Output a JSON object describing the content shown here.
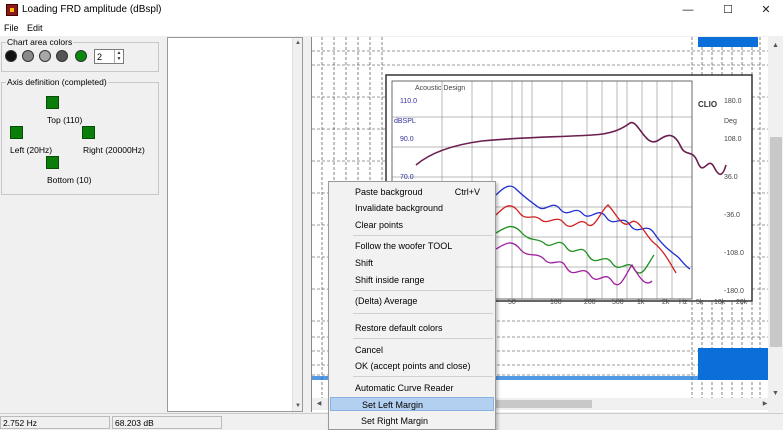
{
  "window": {
    "title": "Loading FRD amplitude (dBspl)",
    "minimize": "—",
    "maximize": "☐",
    "close": "✕"
  },
  "menu": [
    "File",
    "Edit"
  ],
  "chart_area_colors": {
    "label": "Chart area colors",
    "dots": [
      "#111111",
      "#8a8a8a",
      "#a8a8a8",
      "#555555",
      "#0a8a0a"
    ],
    "spin_value": "2"
  },
  "axis_definition": {
    "label": "Axis definition (completed)",
    "top": "Top (110)",
    "left": "Left (20Hz)",
    "right": "Right (20000Hz)",
    "bottom": "Bottom (10)"
  },
  "chart": {
    "inner_label": "Acoustic Design",
    "brand": "CLIO",
    "left_ticks": [
      "110.0",
      "dBSPL",
      "90.0",
      "70.0"
    ],
    "right_ticks": [
      "180.0",
      "Deg",
      "108.0",
      "36.0",
      "-36.0",
      "-108.0",
      "-180.0"
    ],
    "x_ticks": [
      "50",
      "100",
      "200",
      "500",
      "1k",
      "2k",
      "Hz",
      "5k",
      "10k",
      "20k"
    ]
  },
  "context_menu": {
    "items": [
      {
        "label": "Paste backgroud",
        "shortcut": "Ctrl+V"
      },
      {
        "label": "Invalidate background"
      },
      {
        "label": "Clear points"
      },
      {
        "label": "Follow the woofer TOOL"
      },
      {
        "label": "Shift"
      },
      {
        "label": "Shift inside range"
      },
      {
        "label": "(Delta) Average"
      },
      {
        "label": "Restore default colors"
      },
      {
        "label": "Cancel"
      },
      {
        "label": "OK (accept points and close)"
      },
      {
        "label": "Automatic Curve Reader"
      },
      {
        "label": "Set Left Margin"
      },
      {
        "label": "Set Right Margin"
      }
    ]
  },
  "status": {
    "frequency": "2.752 Hz",
    "level": "68.203 dB"
  },
  "colors": {
    "accent_blue": "#0a6fd8",
    "curve_purple": "#6b2050",
    "curve_blue": "#2030d0",
    "curve_red": "#d02020",
    "curve_green": "#209020",
    "curve_magenta": "#a020a0"
  }
}
